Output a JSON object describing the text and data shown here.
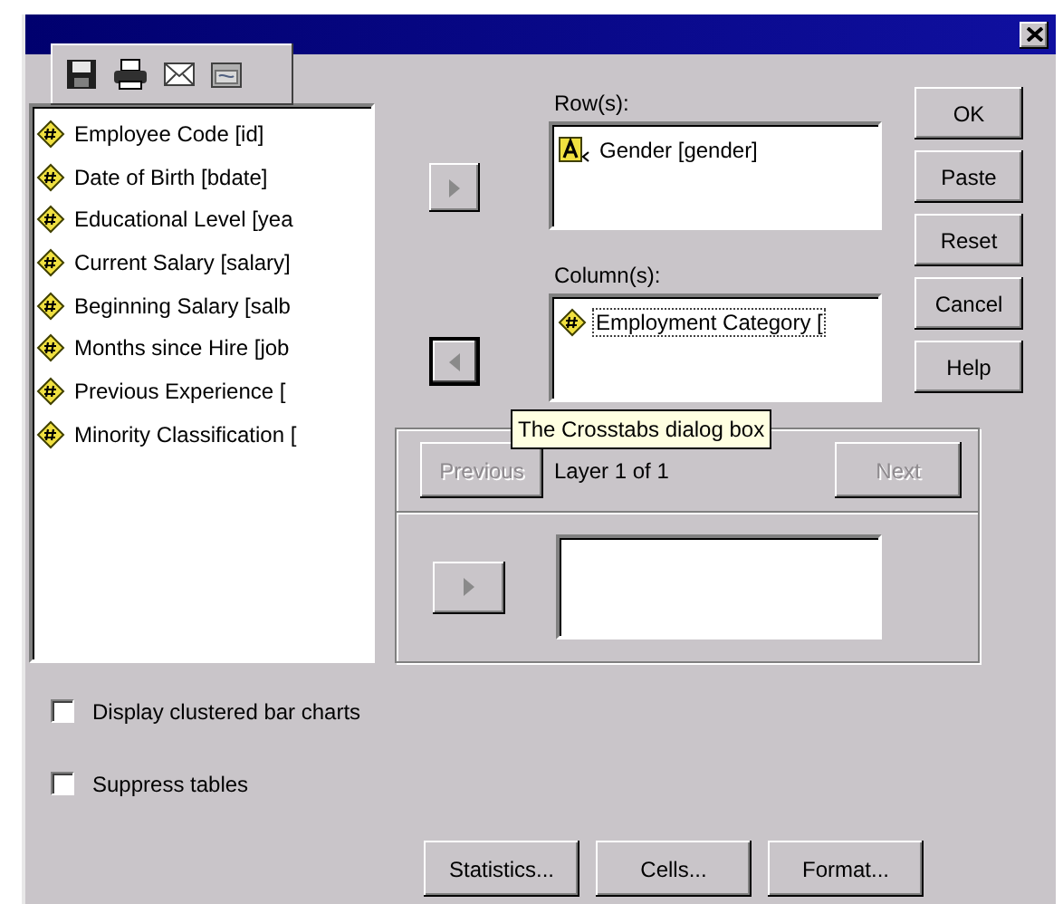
{
  "variables": [
    {
      "label": "Employee Code [id]",
      "kind": "scale"
    },
    {
      "label": "Date of Birth [bdate]",
      "kind": "scale"
    },
    {
      "label": "Educational Level [yea",
      "kind": "scale"
    },
    {
      "label": "Current Salary [salary]",
      "kind": "scale"
    },
    {
      "label": "Beginning Salary [salb",
      "kind": "scale"
    },
    {
      "label": "Months since Hire [job",
      "kind": "scale"
    },
    {
      "label": "Previous Experience [",
      "kind": "scale"
    },
    {
      "label": "Minority Classification [",
      "kind": "scale"
    }
  ],
  "move_buttons": [
    {
      "kind": "right",
      "focused": false
    },
    {
      "kind": "left",
      "focused": true
    }
  ],
  "rows": {
    "label": "Row(s):",
    "items": [
      {
        "label": "Gender [gender]",
        "kind": "nominal",
        "focused": false
      }
    ]
  },
  "columns": {
    "label": "Column(s):",
    "items": [
      {
        "label": "Employment Category [",
        "kind": "scale",
        "focused": true
      }
    ]
  },
  "actions": [
    {
      "label": "OK"
    },
    {
      "label": "Paste"
    },
    {
      "label": "Reset"
    },
    {
      "label": "Cancel"
    },
    {
      "label": "Help"
    }
  ],
  "layer": {
    "previous": {
      "label": "Previous",
      "disabled": true
    },
    "text": "Layer 1 of 1",
    "next": {
      "label": "Next",
      "disabled": true
    },
    "move_button": {
      "kind": "right",
      "focused": false
    }
  },
  "tooltip": "The Crosstabs dialog box",
  "options": [
    {
      "label": "Display clustered bar charts",
      "checked": false
    },
    {
      "label": "Suppress tables",
      "checked": false
    }
  ],
  "sub_dialogs": [
    "Statistics...",
    "Cells...",
    "Format..."
  ]
}
